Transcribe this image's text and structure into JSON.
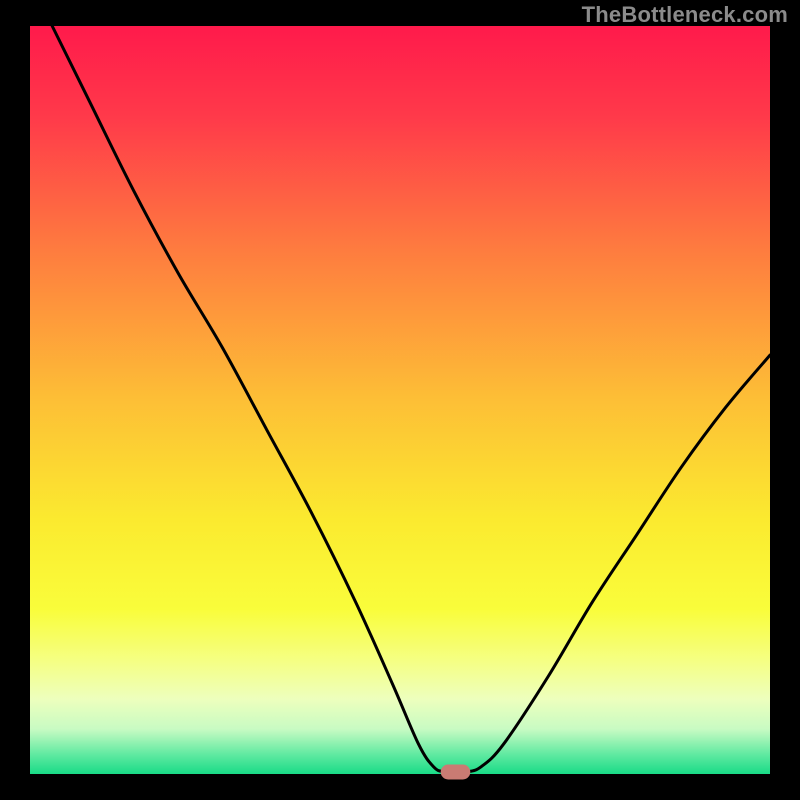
{
  "watermark": "TheBottleneck.com",
  "chart_data": {
    "type": "line",
    "title": "",
    "xlabel": "",
    "ylabel": "",
    "xlim": [
      0,
      100
    ],
    "ylim": [
      0,
      100
    ],
    "grid": false,
    "legend": false,
    "background": {
      "type": "vertical-gradient",
      "stops": [
        {
          "pos": 0.0,
          "color": "#ff1a4b"
        },
        {
          "pos": 0.12,
          "color": "#ff394a"
        },
        {
          "pos": 0.3,
          "color": "#fe7c3f"
        },
        {
          "pos": 0.5,
          "color": "#fdbf36"
        },
        {
          "pos": 0.66,
          "color": "#fbea2f"
        },
        {
          "pos": 0.78,
          "color": "#f9fd3b"
        },
        {
          "pos": 0.85,
          "color": "#f5ff85"
        },
        {
          "pos": 0.9,
          "color": "#edffbd"
        },
        {
          "pos": 0.94,
          "color": "#c8fbc3"
        },
        {
          "pos": 0.975,
          "color": "#5de9a0"
        },
        {
          "pos": 1.0,
          "color": "#19db87"
        }
      ]
    },
    "series": [
      {
        "name": "bottleneck-curve",
        "stroke": "#000000",
        "stroke_width": 3,
        "points": [
          {
            "x": 3.0,
            "y": 100.0
          },
          {
            "x": 8.0,
            "y": 90.0
          },
          {
            "x": 14.0,
            "y": 78.0
          },
          {
            "x": 20.0,
            "y": 67.0
          },
          {
            "x": 26.0,
            "y": 57.0
          },
          {
            "x": 32.0,
            "y": 46.0
          },
          {
            "x": 38.0,
            "y": 35.0
          },
          {
            "x": 44.0,
            "y": 23.0
          },
          {
            "x": 49.0,
            "y": 12.0
          },
          {
            "x": 52.5,
            "y": 4.0
          },
          {
            "x": 54.5,
            "y": 1.0
          },
          {
            "x": 56.0,
            "y": 0.3
          },
          {
            "x": 59.0,
            "y": 0.3
          },
          {
            "x": 61.0,
            "y": 1.0
          },
          {
            "x": 64.0,
            "y": 4.0
          },
          {
            "x": 70.0,
            "y": 13.0
          },
          {
            "x": 76.0,
            "y": 23.0
          },
          {
            "x": 82.0,
            "y": 32.0
          },
          {
            "x": 88.0,
            "y": 41.0
          },
          {
            "x": 94.0,
            "y": 49.0
          },
          {
            "x": 100.0,
            "y": 56.0
          }
        ]
      }
    ],
    "marker": {
      "shape": "rounded-capsule",
      "x": 57.5,
      "y": 0.0,
      "width": 4.0,
      "height": 2.0,
      "color": "#c97b73"
    }
  }
}
